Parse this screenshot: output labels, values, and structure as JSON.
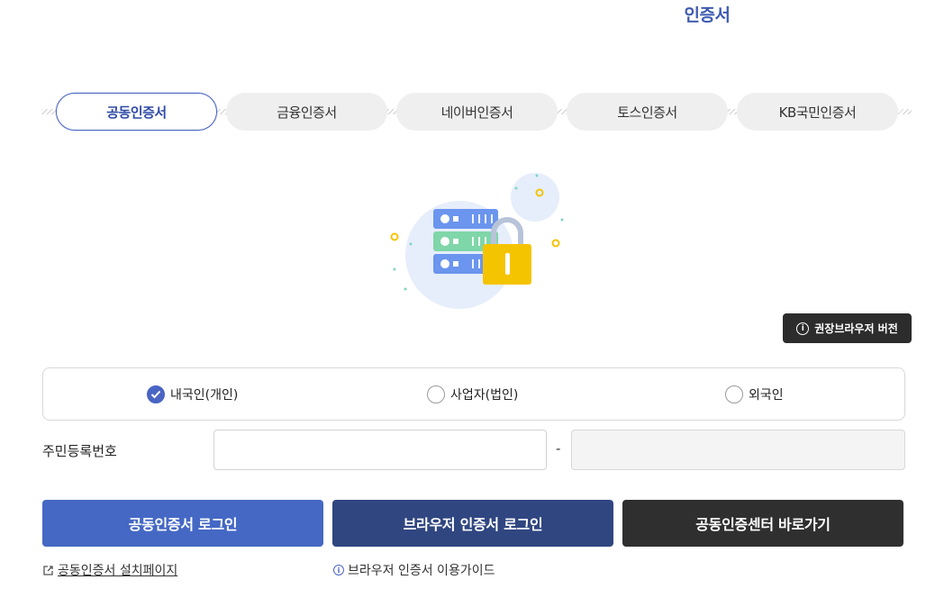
{
  "header": {
    "title": "인증서"
  },
  "tabs": [
    {
      "label": "공동인증서",
      "active": true
    },
    {
      "label": "금융인증서",
      "active": false
    },
    {
      "label": "네이버인증서",
      "active": false
    },
    {
      "label": "토스인증서",
      "active": false
    },
    {
      "label": "KB국민인증서",
      "active": false
    }
  ],
  "illustration": {
    "icon": "server-lock-icon"
  },
  "browser_badge": {
    "label": "권장브라우저 버전",
    "icon": "info-icon"
  },
  "user_type": {
    "options": [
      {
        "label": "내국인(개인)",
        "checked": true
      },
      {
        "label": "사업자(법인)",
        "checked": false
      },
      {
        "label": "외국인",
        "checked": false
      }
    ]
  },
  "id_field": {
    "label": "주민등록번호",
    "first_value": "",
    "second_value": "",
    "separator": "-"
  },
  "buttons": {
    "cert_login": "공동인증서 로그인",
    "browser_login": "브라우저 인증서 로그인",
    "center": "공동인증센터 바로가기"
  },
  "links": {
    "install": "공동인증서 설치페이지",
    "guide": "브라우저 인증서 이용가이드"
  },
  "colors": {
    "accent": "#4468c4",
    "navy": "#304680",
    "dark": "#2f2f2f",
    "lock": "#f5c400"
  }
}
